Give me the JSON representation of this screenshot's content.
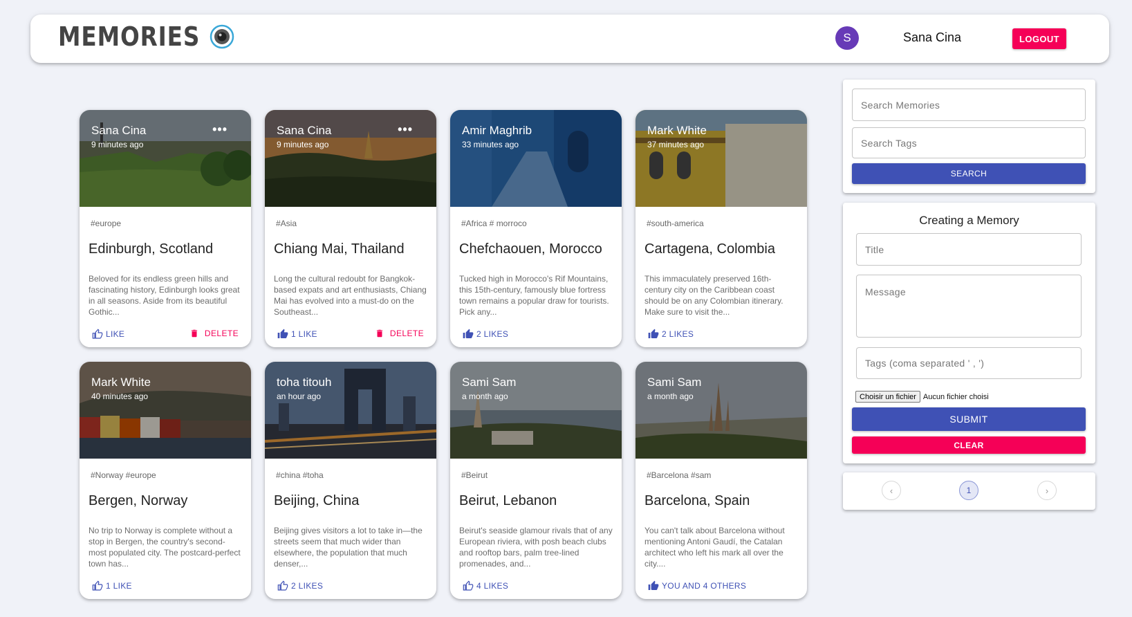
{
  "header": {
    "brand": "MEMORIES",
    "user_initial": "S",
    "user_name": "Sana Cina",
    "logout_label": "LOGOUT"
  },
  "colors": {
    "primary": "#3f51b5",
    "secondary": "#f50057",
    "avatar": "#673ab7",
    "background": "#f0f2f8"
  },
  "posts": [
    {
      "author": "Sana Cina",
      "time": "9 minutes ago",
      "tags": "#europe",
      "title": "Edinburgh, Scotland",
      "message": "Beloved for its endless green hills and fascinating history, Edinburgh looks great in all seasons. Aside from its beautiful Gothic...",
      "like_label": "LIKE",
      "delete_label": "DELETE",
      "more_label": "•••"
    },
    {
      "author": "Sana Cina",
      "time": "9 minutes ago",
      "tags": "#Asia",
      "title": "Chiang Mai, Thailand",
      "message": "Long the cultural redoubt for Bangkok-based expats and art enthusiasts, Chiang Mai has evolved into a must-do on the Southeast...",
      "like_label": "1 LIKE",
      "delete_label": "DELETE",
      "more_label": "•••"
    },
    {
      "author": "Amir Maghrib",
      "time": "33 minutes ago",
      "tags": "#Africa # morroco",
      "title": "Chefchaouen, Morocco",
      "message": "Tucked high in Morocco's Rif Mountains, this 15th-century, famously blue fortress town remains a popular draw for tourists. Pick any...",
      "like_label": "2 LIKES"
    },
    {
      "author": "Mark White",
      "time": "37 minutes ago",
      "tags": "#south-america",
      "title": "Cartagena, Colombia",
      "message": "This immaculately preserved 16th-century city on the Caribbean coast should be on any Colombian itinerary. Make sure to visit the...",
      "like_label": "2 LIKES"
    },
    {
      "author": "Mark White",
      "time": "40 minutes ago",
      "tags": "#Norway #europe",
      "title": "Bergen, Norway",
      "message": "No trip to Norway is complete without a stop in Bergen, the country's second-most populated city. The postcard-perfect town has...",
      "like_label": "1 LIKE"
    },
    {
      "author": "toha titouh",
      "time": "an hour ago",
      "tags": "#china #toha",
      "title": "Beijing, China",
      "message": "Beijing gives visitors a lot to take in—the streets seem that much wider than elsewhere, the population that much denser,...",
      "like_label": "2 LIKES"
    },
    {
      "author": "Sami Sam",
      "time": "a month ago",
      "tags": "#Beirut",
      "title": "Beirut, Lebanon",
      "message": "Beirut's seaside glamour rivals that of any European riviera, with posh beach clubs and rooftop bars, palm tree-lined promenades, and...",
      "like_label": "4 LIKES"
    },
    {
      "author": "Sami Sam",
      "time": "a month ago",
      "tags": "#Barcelona #sam",
      "title": "Barcelona, Spain",
      "message": "You can't talk about Barcelona without mentioning Antoni Gaudí, the Catalan architect who left his mark all over the city....",
      "like_label": "YOU AND 4 OTHERS"
    }
  ],
  "search": {
    "memories_placeholder": "Search Memories",
    "tags_placeholder": "Search Tags",
    "button_label": "SEARCH"
  },
  "form": {
    "heading": "Creating a Memory",
    "title_placeholder": "Title",
    "message_placeholder": "Message",
    "tags_placeholder": "Tags (coma separated ' , ')",
    "file_button": "Choisir un fichier",
    "file_status": "Aucun fichier choisi",
    "submit_label": "SUBMIT",
    "clear_label": "CLEAR"
  },
  "pagination": {
    "prev_label": "‹",
    "current_page": "1",
    "next_label": "›"
  }
}
